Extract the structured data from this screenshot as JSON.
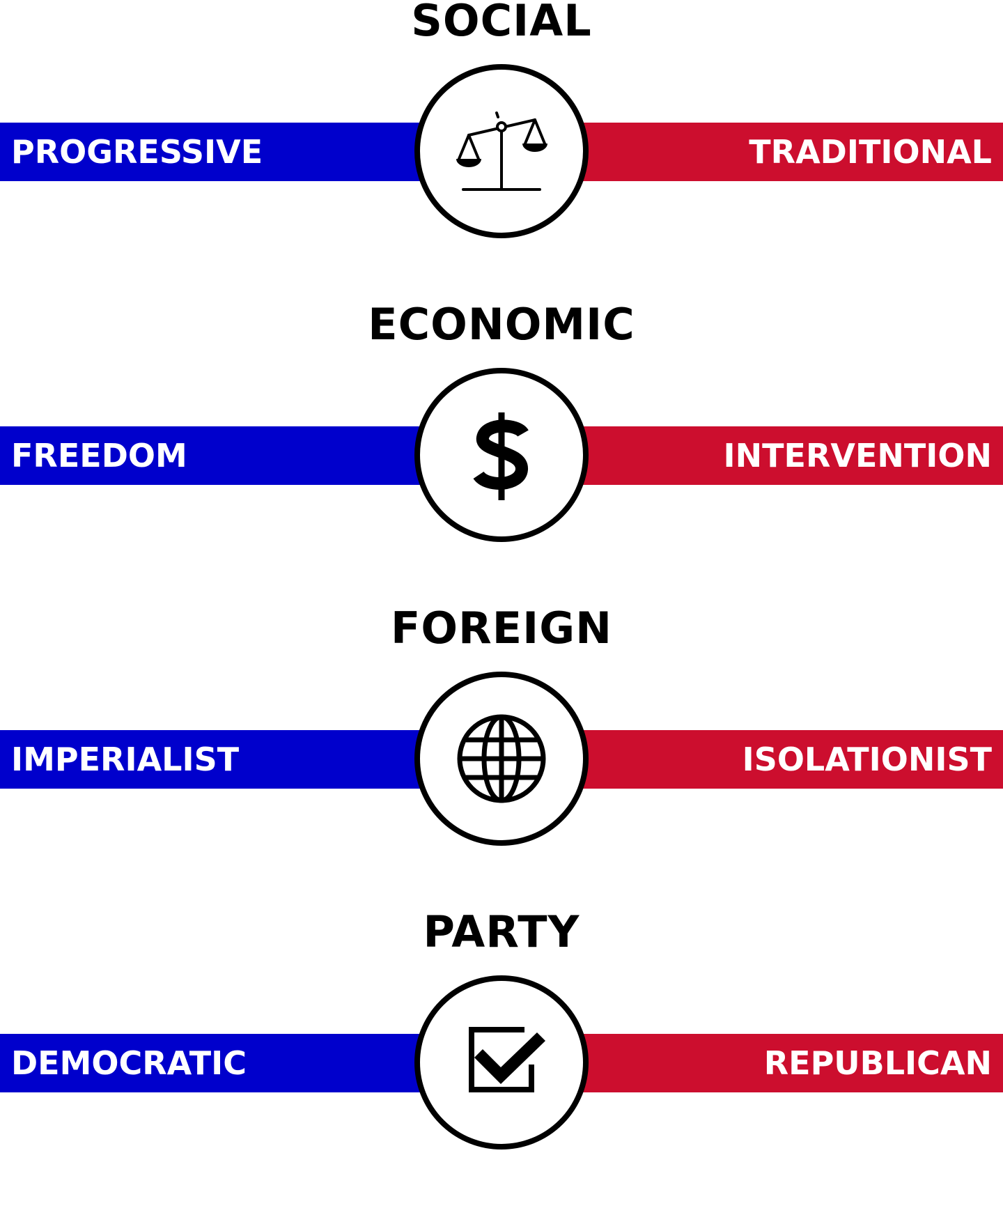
{
  "colors": {
    "left": "#0000cc",
    "right": "#cc0e2e",
    "outline": "#000000"
  },
  "axes": [
    {
      "title": "SOCIAL",
      "left_label": "PROGRESSIVE",
      "right_label": "TRADITIONAL",
      "icon": "scales-icon"
    },
    {
      "title": "ECONOMIC",
      "left_label": "FREEDOM",
      "right_label": "INTERVENTION",
      "icon": "dollar-icon"
    },
    {
      "title": "FOREIGN",
      "left_label": "IMPERIALIST",
      "right_label": "ISOLATIONIST",
      "icon": "globe-icon"
    },
    {
      "title": "PARTY",
      "left_label": "DEMOCRATIC",
      "right_label": "REPUBLICAN",
      "icon": "checkbox-icon"
    }
  ]
}
